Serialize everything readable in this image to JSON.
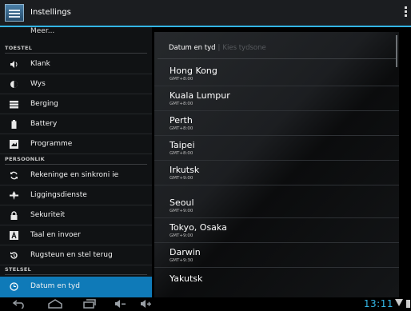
{
  "app": {
    "title": "Instellings"
  },
  "left": {
    "meer": "Meer...",
    "sections": {
      "toestel": "TOESTEL",
      "persoonlik": "PERSOONLIK",
      "stelsel": "STELSEL"
    },
    "items": [
      {
        "label": "Klank",
        "icon": "speaker-icon"
      },
      {
        "label": "Wys",
        "icon": "display-brightness-icon"
      },
      {
        "label": "Berging",
        "icon": "storage-icon"
      },
      {
        "label": "Battery",
        "icon": "battery-icon"
      },
      {
        "label": "Programme",
        "icon": "apps-icon"
      },
      {
        "label": "Rekeninge en sinkroni    ie",
        "icon": "sync-icon"
      },
      {
        "label": "Liggingsdienste",
        "icon": "location-icon"
      },
      {
        "label": "Sekuriteit",
        "icon": "lock-icon"
      },
      {
        "label": "Taal en invoer",
        "icon": "language-icon"
      },
      {
        "label": "Rugsteun en stel terug",
        "icon": "backup-icon"
      },
      {
        "label": "Datum en tyd",
        "icon": "clock-icon"
      }
    ]
  },
  "right": {
    "breadcrumb": "Datum en tyd",
    "breadcrumb_sub": "Kies tydsone",
    "timezones": [
      {
        "name": "Hong Kong",
        "gmt": "GMT+8:00"
      },
      {
        "name": "Kuala Lumpur",
        "gmt": "GMT+8:00"
      },
      {
        "name": "Perth",
        "gmt": "GMT+8:00"
      },
      {
        "name": "Taipei",
        "gmt": "GMT+8:00"
      },
      {
        "name": "Irkutsk",
        "gmt": "GMT+9:00"
      },
      {
        "name": "Seoul",
        "gmt": "GMT+9:00"
      },
      {
        "name": "Tokyo, Osaka",
        "gmt": "GMT+9:00"
      },
      {
        "name": "Darwin",
        "gmt": "GMT+9:30"
      },
      {
        "name": "Yakutsk",
        "gmt": ""
      }
    ]
  },
  "statusbar": {
    "time": "13:11"
  },
  "colors": {
    "accent": "#33b5e5",
    "selected": "#0f7ab8"
  }
}
